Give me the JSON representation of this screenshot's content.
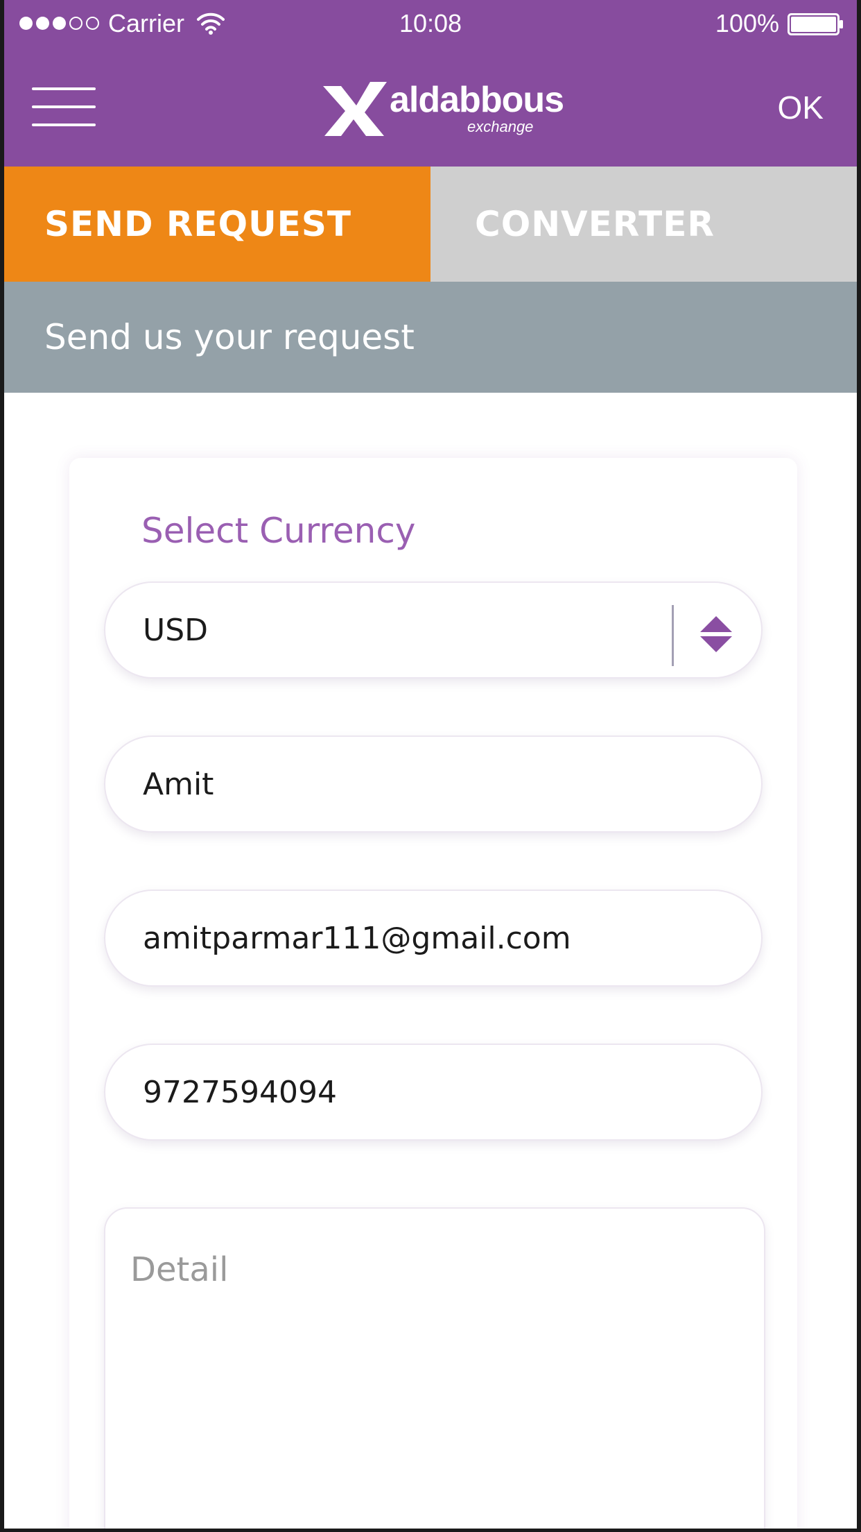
{
  "status_bar": {
    "carrier": "Carrier",
    "time": "10:08",
    "battery": "100%",
    "signal_bars_filled": 3,
    "signal_bars_total": 5,
    "battery_level": 1.0
  },
  "nav": {
    "logo_name": "aldabbous",
    "logo_sub": "exchange",
    "ok_label": "OK"
  },
  "tabs": [
    {
      "label": "SEND REQUEST",
      "active": true
    },
    {
      "label": "CONVERTER",
      "active": false
    }
  ],
  "subtitle": "Send us your request",
  "form": {
    "currency_label": "Select Currency",
    "currency_value": "USD",
    "name_value": "Amit",
    "email_value": "amitparmar111@gmail.com",
    "phone_value": "9727594094",
    "detail_placeholder": "Detail"
  },
  "colors": {
    "brand_purple": "#874c9e",
    "tab_active_orange": "#ee8716",
    "tab_inactive_gray": "#cfcfcf",
    "subtitle_gray": "#94a1a8",
    "label_purple": "#9a5fb2"
  },
  "icons": {
    "menu": "hamburger-menu-icon",
    "wifi": "wifi-icon",
    "battery": "battery-icon",
    "select_arrows": "select-arrows-icon",
    "logo_mark": "logo-x-icon"
  }
}
